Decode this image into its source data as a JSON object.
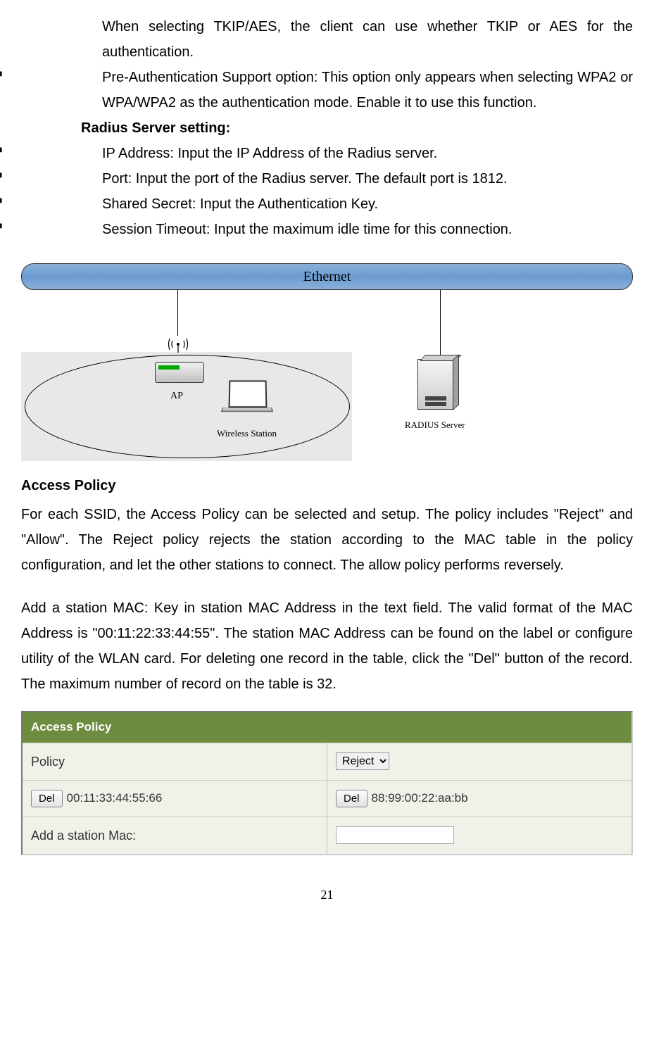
{
  "para1": "When selecting TKIP/AES, the client can use whether TKIP or AES for the authentication.",
  "bullet_preauth": "Pre-Authentication Support option: This option only appears when selecting WPA2 or WPA/WPA2 as the authentication mode. Enable it to use this function.",
  "radius_heading": "Radius Server setting:",
  "radius_ip": "IP Address: Input the IP Address of the Radius server.",
  "radius_port": "Port: Input the port of the Radius server. The default port is 1812.",
  "radius_secret": "Shared Secret: Input the Authentication Key.",
  "radius_timeout": "Session Timeout: Input the maximum idle time for this connection.",
  "diagram": {
    "ethernet": "Ethernet",
    "ap": "AP",
    "ws": "Wireless Station",
    "server": "RADIUS Server"
  },
  "access_title": "Access Policy",
  "access_body": "For each SSID, the Access Policy can be selected and setup. The policy includes \"Reject\" and \"Allow\". The Reject policy rejects the station according to the MAC table in the policy configuration, and let the other stations to connect. The allow policy performs reversely.",
  "add_mac_body": "Add a station MAC: Key in station MAC Address in the text field. The valid format of the MAC Address is \"00:11:22:33:44:55\". The station MAC Address can be found on the label or configure utility of the WLAN card. For deleting one record in the table, click the \"Del\" button of the record. The maximum number of record on the table is 32.",
  "panel": {
    "header": "Access Policy",
    "policy_label": "Policy",
    "policy_value": "Reject",
    "del_label": "Del",
    "mac1": "00:11:33:44:55:66",
    "mac2": "88:99:00:22:aa:bb",
    "add_label": "Add a station Mac:"
  },
  "page_number": "21"
}
